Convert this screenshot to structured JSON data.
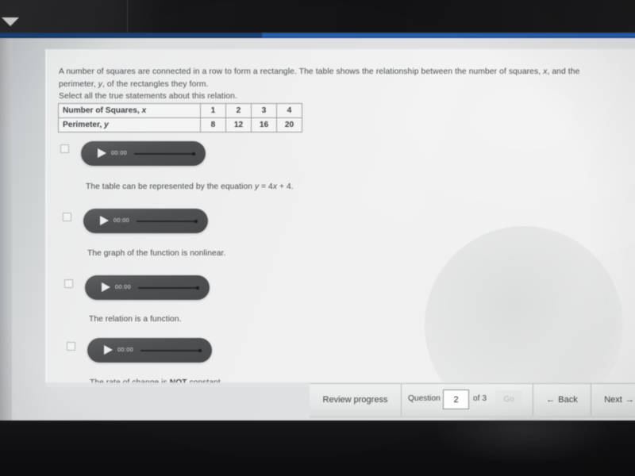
{
  "question": {
    "stem": "A number of squares are connected in a row to form a rectangle. The table shows the relationship between the number of squares, x, and the perimeter, y, of the rectangles they form.",
    "instruction": "Select all the true statements about this relation."
  },
  "table": {
    "rows": [
      {
        "header": "Number of Squares,",
        "header_var": "x",
        "values": [
          "1",
          "2",
          "3",
          "4"
        ]
      },
      {
        "header": "Perimeter,",
        "header_var": "y",
        "values": [
          "8",
          "12",
          "16",
          "20"
        ]
      }
    ]
  },
  "player": {
    "time": "00:00",
    "play_icon": "play-triangle-icon"
  },
  "options": [
    {
      "label_pre": "The table can be represented by the equation ",
      "var1": "y",
      "mid": " = 4",
      "var2": "x",
      "post": " + 4.",
      "checked": false
    },
    {
      "label_pre": "The graph of the function is nonlinear.",
      "checked": false
    },
    {
      "label_pre": "The relation is a function.",
      "checked": false
    },
    {
      "label_pre": "The rate of change is ",
      "strong": "NOT",
      "post": " constant.",
      "checked": false
    }
  ],
  "toolbar": {
    "review_progress": "Review progress",
    "question_word": "Question",
    "question_number": "2",
    "of_label": "of 3",
    "go_label": "Go",
    "back_label": "Back",
    "next_label": "Next",
    "back_icon": "arrow-left-icon",
    "next_icon": "arrow-right-icon"
  },
  "chrome": {
    "caret_icon": "triangle-down-icon",
    "accent_color": "#2a64b0"
  }
}
